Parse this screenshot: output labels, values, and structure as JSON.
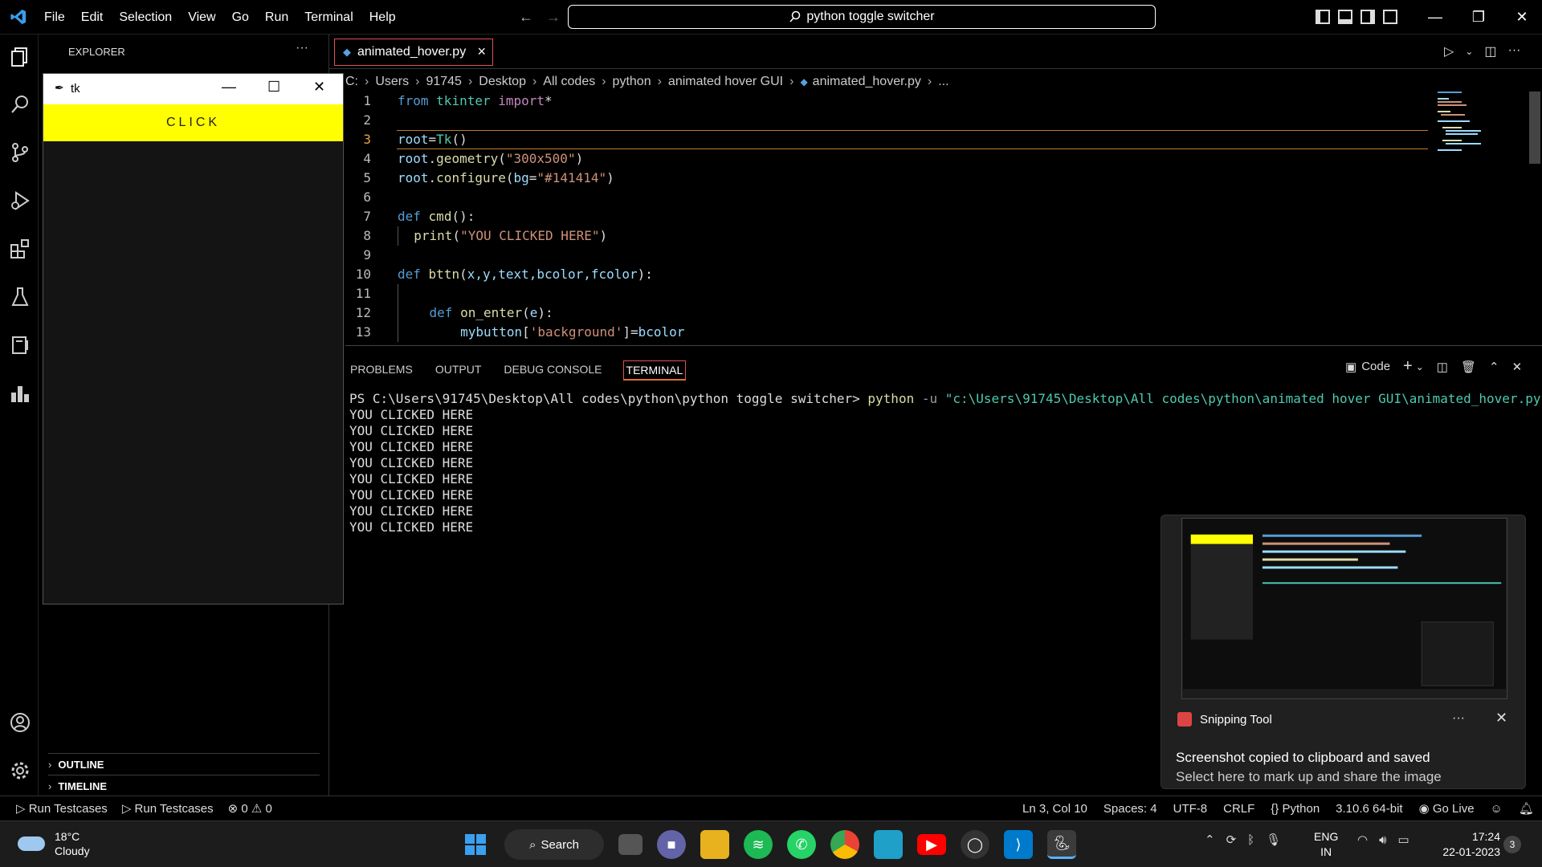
{
  "titlebar": {
    "menu": [
      "File",
      "Edit",
      "Selection",
      "View",
      "Go",
      "Run",
      "Terminal",
      "Help"
    ],
    "command_center": "python toggle switcher"
  },
  "sidebar": {
    "header": "EXPLORER",
    "more": "···",
    "sections": [
      "OUTLINE",
      "TIMELINE"
    ]
  },
  "editor": {
    "tab": "animated_hover.py",
    "breadcrumb": [
      "C:",
      "Users",
      "91745",
      "Desktop",
      "All codes",
      "python",
      "animated hover GUI",
      "animated_hover.py",
      "..."
    ],
    "line_numbers": [
      "1",
      "2",
      "3",
      "4",
      "5",
      "6",
      "7",
      "8",
      "9",
      "10",
      "11",
      "12",
      "13"
    ],
    "lines": {
      "l1_kw": "from",
      "l1_mod": "tkinter",
      "l1_imp": "import",
      "l1_rest": "*",
      "l3_var": "root",
      "l3_rest": "=",
      "l3_cls": "Tk",
      "l3_paren": "()",
      "l4_var": "root",
      "l4_dot": ".",
      "l4_fn": "geometry",
      "l4_open": "(",
      "l4_str": "\"300x500\"",
      "l4_close": ")",
      "l5_var": "root",
      "l5_dot": ".",
      "l5_fn": "configure",
      "l5_open": "(",
      "l5_arg": "bg",
      "l5_eq": "=",
      "l5_str": "\"#141414\"",
      "l5_close": ")",
      "l7_kw": "def",
      "l7_fn": "cmd",
      "l7_rest": "():",
      "l8_fn": "print",
      "l8_open": "(",
      "l8_str": "\"YOU CLICKED HERE\"",
      "l8_close": ")",
      "l10_kw": "def",
      "l10_fn": "bttn",
      "l10_open": "(",
      "l10_args": "x,y,text,bcolor,fcolor",
      "l10_close": "):",
      "l12_kw": "def",
      "l12_fn": "on_enter",
      "l12_open": "(",
      "l12_arg": "e",
      "l12_close": "):",
      "l13_var": "mybutton",
      "l13_open": "[",
      "l13_str": "'background'",
      "l13_close": "]=",
      "l13_val": "bcolor"
    }
  },
  "panel": {
    "tabs": [
      "PROBLEMS",
      "OUTPUT",
      "DEBUG CONSOLE",
      "TERMINAL"
    ],
    "shell_label": "Code",
    "terminal": {
      "prompt": "PS C:\\Users\\91745\\Desktop\\All codes\\python\\python toggle switcher> ",
      "cmd": "python",
      "flag": " -u ",
      "path": "\"c:\\Users\\91745\\Desktop\\All codes\\python\\animated hover GUI\\animated_hover.py\"",
      "output": [
        "YOU CLICKED HERE",
        "YOU CLICKED HERE",
        "YOU CLICKED HERE",
        "YOU CLICKED HERE",
        "YOU CLICKED HERE",
        "YOU CLICKED HERE",
        "YOU CLICKED HERE",
        "YOU CLICKED HERE"
      ]
    }
  },
  "tk_window": {
    "title": "tk",
    "button": "CLICK",
    "button_color": "#ffff00",
    "bg_color": "#141414"
  },
  "statusbar": {
    "left": [
      "Run Testcases",
      "Run Testcases",
      "0",
      "0"
    ],
    "right": [
      "Ln 3, Col 10",
      "Spaces: 4",
      "UTF-8",
      "CRLF",
      "Python",
      "3.10.6 64-bit",
      "Go Live"
    ]
  },
  "notification": {
    "app": "Snipping Tool",
    "message": "Screenshot copied to clipboard and saved",
    "sub": "Select here to mark up and share the image"
  },
  "taskbar": {
    "temp": "18°C",
    "weather": "Cloudy",
    "search": "Search",
    "lang1": "ENG",
    "lang2": "IN",
    "time": "17:24",
    "date": "22-01-2023",
    "notif_count": "3"
  }
}
